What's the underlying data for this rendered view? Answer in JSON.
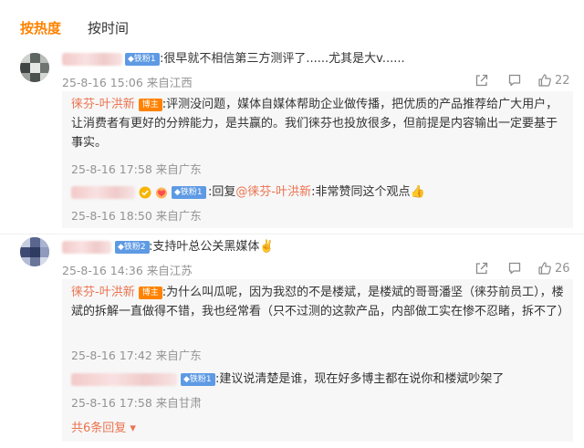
{
  "tabs": [
    {
      "label": "按热度"
    },
    {
      "label": "按时间"
    }
  ],
  "comments": [
    {
      "badge": "铁粉1",
      "text": ":很早就不相信第三方测评了......尤其是大v......",
      "meta": "25-8-16 15:06 来自江西",
      "likes": "22",
      "replies": [
        {
          "name": "徕芬-叶洪新",
          "badge": "博主",
          "text": ":评测没问题，媒体自媒体帮助企业做传播，把优质的产品推荐给广大用户，让消费者有更好的分辨能力，是共赢的。我们徕芬也投放很多，但前提是内容输出一定要基于事实。",
          "meta": "25-8-16 17:58 来自广东"
        },
        {
          "badge": "铁粉1",
          "prefix": ":回复",
          "mention": "@徕芬-叶洪新",
          "text": ":非常赞同这个观点👍",
          "meta": "25-8-16 18:50 来自广东"
        }
      ]
    },
    {
      "badge": "铁粉2",
      "text": ":支持叶总公关黑媒体✌️",
      "meta": "25-8-16 14:36 来自江苏",
      "likes": "26",
      "replies": [
        {
          "name": "徕芬-叶洪新",
          "badge": "博主",
          "text": ":为什么叫瓜呢，因为我怼的不是楼斌，是楼斌的哥哥潘坚（徕芬前员工），楼斌的拆解一直做得不错，我也经常看（只不过测的这款产品，内部做工实在惨不忍睹，拆不了）",
          "meta": "25-8-16 17:42 来自广东"
        },
        {
          "badge": "铁粉1",
          "text": ":建议说清楚是谁，现在好多博主都在说你和楼斌吵架了",
          "meta": "25-8-16 17:58 来自甘肃"
        }
      ],
      "more_replies": "共6条回复 ▾"
    }
  ],
  "colors": {
    "accent": "#ff8200",
    "name": "#eb7350",
    "fan_badge": "#5e9ae4",
    "meta": "#939393",
    "reply_bg": "#f7f7f7"
  },
  "icons": [
    "share-icon",
    "comment-icon",
    "like-icon",
    "heart-icon"
  ]
}
